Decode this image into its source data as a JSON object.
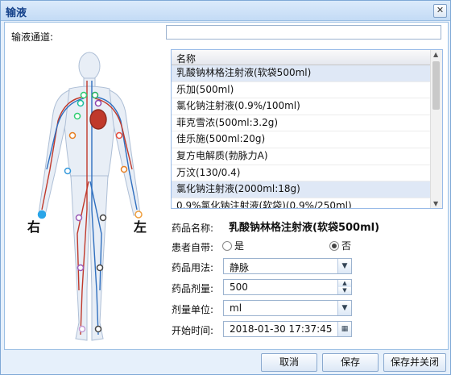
{
  "window": {
    "title": "输液",
    "close_glyph": "✕"
  },
  "channel": {
    "label": "输液通道:",
    "right_label": "右",
    "left_label": "左"
  },
  "search": {
    "value": ""
  },
  "grid": {
    "header": "名称",
    "rows": [
      "乳酸钠林格注射液(软袋500ml)",
      "乐加(500ml)",
      "氯化钠注射液(0.9%/100ml)",
      "菲克雪浓(500ml:3.2g)",
      "佳乐施(500ml:20g)",
      "复方电解质(勃脉力A)",
      "万汶(130/0.4)",
      "氯化钠注射液(2000ml:18g)",
      "0.9%氯化钠注射液(软袋)(0.9%/250ml)"
    ],
    "selected_index": 0,
    "hover_index": 7
  },
  "form": {
    "drug_name_label": "药品名称:",
    "drug_name_value": "乳酸钠林格注射液(软袋500ml)",
    "self_bring_label": "患者自带:",
    "yes_label": "是",
    "no_label": "否",
    "self_bring_selected": "否",
    "usage_label": "药品用法:",
    "usage_value": "静脉",
    "dose_label": "药品剂量:",
    "dose_value": "500",
    "unit_label": "剂量单位:",
    "unit_value": "ml",
    "start_label": "开始时间:",
    "start_value": "2018-01-30 17:37:45"
  },
  "buttons": {
    "cancel": "取消",
    "save": "保存",
    "save_close": "保存并关闭"
  },
  "colors": {
    "title": "#15428b",
    "selected_row": "#dfe8f6",
    "artery": "#c0392b",
    "vein": "#2f6fbf",
    "point_selected": "#2aa5e8"
  }
}
